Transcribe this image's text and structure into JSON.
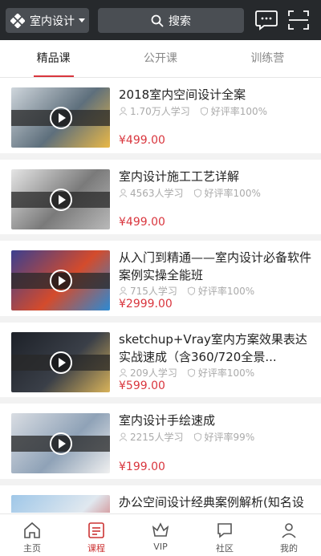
{
  "header": {
    "category_label": "室内设计",
    "search_label": "搜索"
  },
  "tabs": [
    {
      "label": "精品课",
      "active": true
    },
    {
      "label": "公开课",
      "active": false
    },
    {
      "label": "训练营",
      "active": false
    }
  ],
  "courses": [
    {
      "title": "2018室内空间设计全案",
      "learners": "1.70万人学习",
      "rating": "好评率100%",
      "price": "¥499.00",
      "thumb_colors": [
        "#cfd6dc",
        "#5e6f7c",
        "#e9b847"
      ]
    },
    {
      "title": "室内设计施工工艺详解",
      "learners": "4563人学习",
      "rating": "好评率100%",
      "price": "¥499.00",
      "thumb_colors": [
        "#e5e5e5",
        "#7a7a7a",
        "#b9b9b9"
      ]
    },
    {
      "title": "从入门到精通——室内设计必备软件案例实操全能班",
      "learners": "715人学习",
      "rating": "好评率100%",
      "price": "¥2999.00",
      "thumb_colors": [
        "#3b3f8f",
        "#d44b2c",
        "#2c8ad4"
      ]
    },
    {
      "title": "sketchup+Vray室内方案效果表达实战速成（含360/720全景...",
      "learners": "209人学习",
      "rating": "好评率100%",
      "price": "¥599.00",
      "thumb_colors": [
        "#1d2128",
        "#3a3f48",
        "#d9b35a"
      ]
    },
    {
      "title": "室内设计手绘速成",
      "learners": "2215人学习",
      "rating": "好评率99%",
      "price": "¥199.00",
      "thumb_colors": [
        "#d9dde3",
        "#8fa2b7",
        "#f0f0f0"
      ]
    },
    {
      "title": "办公空间设计经典案例解析(知名设计师案例)",
      "learners": "",
      "rating": "",
      "price": "",
      "thumb_colors": [
        "#9fc7e8",
        "#e0e8ef",
        "#c63b3b"
      ]
    }
  ],
  "bottom_nav": [
    {
      "label": "主页",
      "icon": "home-icon",
      "active": false
    },
    {
      "label": "课程",
      "icon": "course-icon",
      "active": true
    },
    {
      "label": "VIP",
      "icon": "vip-crown-icon",
      "active": false
    },
    {
      "label": "社区",
      "icon": "community-icon",
      "active": false
    },
    {
      "label": "我的",
      "icon": "profile-icon",
      "active": false
    }
  ],
  "colors": {
    "topbar_bg": "#26292c",
    "accent": "#d9363e",
    "price": "#d9363e"
  }
}
